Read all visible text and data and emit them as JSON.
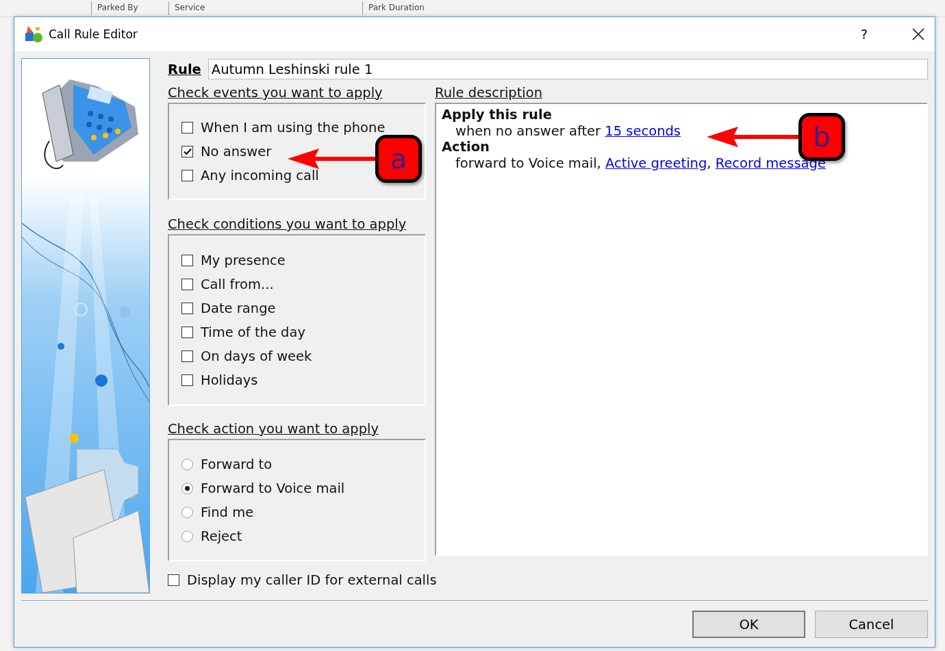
{
  "background_table": {
    "columns": [
      "Parked By",
      "Service",
      "Park Duration"
    ]
  },
  "window": {
    "title": "Call Rule Editor",
    "help": "?"
  },
  "rule": {
    "label": "Rule",
    "value": "Autumn Leshinski rule 1"
  },
  "events": {
    "heading": "Check events you want to apply",
    "items": [
      {
        "label": "When I am using the phone",
        "checked": false
      },
      {
        "label": "No answer",
        "checked": true
      },
      {
        "label": "Any incoming call",
        "checked": false
      }
    ]
  },
  "conditions": {
    "heading": "Check conditions you want to apply",
    "items": [
      {
        "label": "My presence",
        "checked": false
      },
      {
        "label": "Call from...",
        "checked": false
      },
      {
        "label": "Date range",
        "checked": false
      },
      {
        "label": "Time of the day",
        "checked": false
      },
      {
        "label": "On days of week",
        "checked": false
      },
      {
        "label": "Holidays",
        "checked": false
      }
    ]
  },
  "actions": {
    "heading": "Check action you want to apply",
    "items": [
      {
        "label": "Forward to",
        "selected": false
      },
      {
        "label": "Forward to Voice mail",
        "selected": true
      },
      {
        "label": "Find me",
        "selected": false
      },
      {
        "label": "Reject",
        "selected": false
      }
    ]
  },
  "description": {
    "heading": "Rule description",
    "lines": [
      {
        "kind": "title",
        "parts": [
          {
            "text": "Apply this rule",
            "link": false
          }
        ]
      },
      {
        "kind": "detail",
        "parts": [
          {
            "text": "when no answer after ",
            "link": false
          },
          {
            "text": "15 seconds",
            "link": true
          }
        ]
      },
      {
        "kind": "title",
        "parts": [
          {
            "text": "Action",
            "link": false
          }
        ]
      },
      {
        "kind": "detail",
        "parts": [
          {
            "text": "forward to Voice mail, ",
            "link": false
          },
          {
            "text": "Active greeting",
            "link": true
          },
          {
            "text": ", ",
            "link": false
          },
          {
            "text": "Record message",
            "link": true
          }
        ]
      }
    ]
  },
  "caller_id": {
    "label": "Display my caller ID for external calls",
    "checked": false
  },
  "buttons": [
    {
      "label": "OK",
      "default": true
    },
    {
      "label": "Cancel",
      "default": false
    }
  ],
  "annotations": [
    {
      "label": "a"
    },
    {
      "label": "b"
    }
  ]
}
